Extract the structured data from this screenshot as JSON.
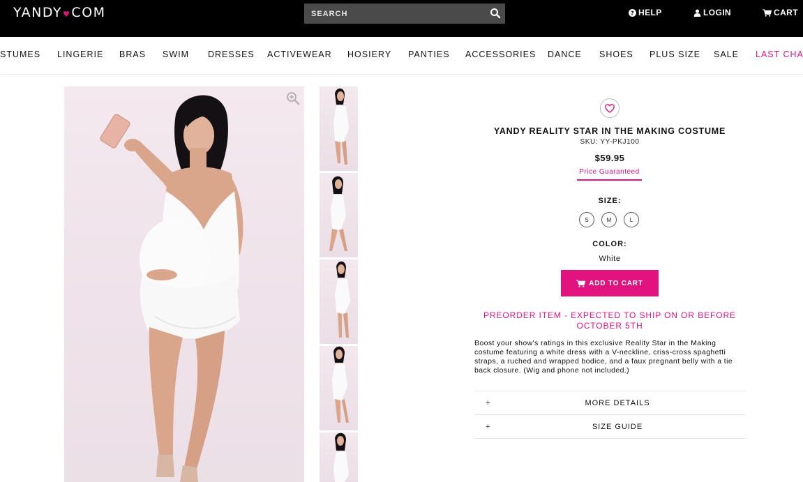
{
  "header": {
    "logo": "YANDY",
    "logo_suffix": "COM",
    "search_placeholder": "SEARCH",
    "help_label": "HELP",
    "login_label": "LOGIN",
    "cart_label": "CART"
  },
  "category_nav": {
    "items": [
      "STUMES",
      "LINGERIE",
      "BRAS",
      "SWIM",
      "DRESSES",
      "ACTIVEWEAR",
      "HOSIERY",
      "PANTIES",
      "ACCESSORIES",
      "DANCE",
      "SHOES",
      "PLUS SIZE",
      "SALE",
      "LAST CHAN"
    ],
    "highlight_color": "#e0137f"
  },
  "product": {
    "title": "YANDY REALITY STAR IN THE MAKING COSTUME",
    "sku": "SKU: YY-PKJ100",
    "price": "$59.95",
    "price_guarantee": "Price Guaranteed",
    "size_label": "SIZE:",
    "sizes": [
      "S",
      "M",
      "L"
    ],
    "color_label": "COLOR:",
    "color_value": "White",
    "add_to_cart_label": "ADD TO CART",
    "preorder_text": "PREORDER ITEM - EXPECTED TO SHIP ON OR BEFORE OCTOBER 5TH",
    "description": "Boost your show's ratings in this exclusive Reality Star in the Making costume featuring a white dress with a V-neckline, criss-cross spaghetti straps, a ruched and wrapped bodice, and a faux pregnant belly with a tie back closure. (Wig and phone not included.)",
    "accordions": [
      {
        "icon": "+",
        "label": "MORE DETAILS"
      },
      {
        "icon": "+",
        "label": "SIZE GUIDE"
      }
    ]
  },
  "icons": {
    "search": "search-icon",
    "help": "question-circle-icon",
    "login": "user-icon",
    "cart": "cart-icon",
    "zoom": "zoom-in-icon",
    "wishlist": "heart-icon"
  },
  "colors": {
    "brand_pink": "#e0137f",
    "header_bg": "#000000",
    "search_bg": "#4a4a4a"
  }
}
